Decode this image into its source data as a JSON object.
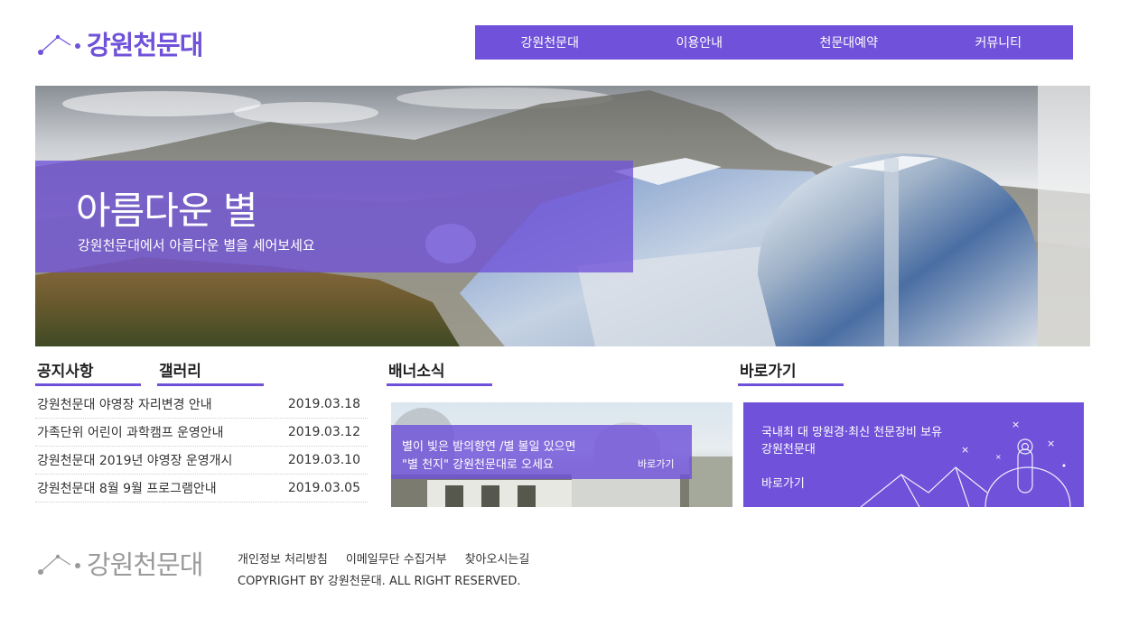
{
  "header": {
    "logo_text": "강원천문대",
    "nav": [
      "강원천문대",
      "이용안내",
      "천문대예약",
      "커뮤니티"
    ]
  },
  "hero": {
    "title": "아름다운 별",
    "subtitle": "강원천문대에서 아름다운 별을 세어보세요"
  },
  "notice": {
    "tab_notice": "공지사항",
    "tab_gallery": "갤러리",
    "items": [
      {
        "title": "강원천문대 야영장 자리변경 안내",
        "date": "2019.03.18"
      },
      {
        "title": "가족단위 어린이 과학캠프 운영안내",
        "date": "2019.03.12"
      },
      {
        "title": "강원천문대 2019년 야영장 운영개시",
        "date": "2019.03.10"
      },
      {
        "title": "강원천문대 8월 9월 프로그램안내",
        "date": "2019.03.05"
      }
    ]
  },
  "banner": {
    "heading": "배너소식",
    "line1": "별이 빛은 밤의향연 /별 볼일 있으면",
    "line2": "\"별 천지\" 강원천문대로 오세요",
    "more": "바로가기"
  },
  "quick": {
    "heading": "바로가기",
    "line1": "국내최 대 망원경·최신 천문장비 보유",
    "line2": "강원천문대",
    "more": "바로가기"
  },
  "footer": {
    "logo_text": "강원천문대",
    "links": [
      "개인정보 처리방침",
      "이메일무단 수집거부",
      "찾아오시는길"
    ],
    "copyright": "COPYRIGHT BY 강원천문대. ALL RIGHT RESERVED."
  },
  "colors": {
    "accent": "#6f52d9",
    "text": "#333333",
    "footer_logo": "#9a9a9a"
  }
}
